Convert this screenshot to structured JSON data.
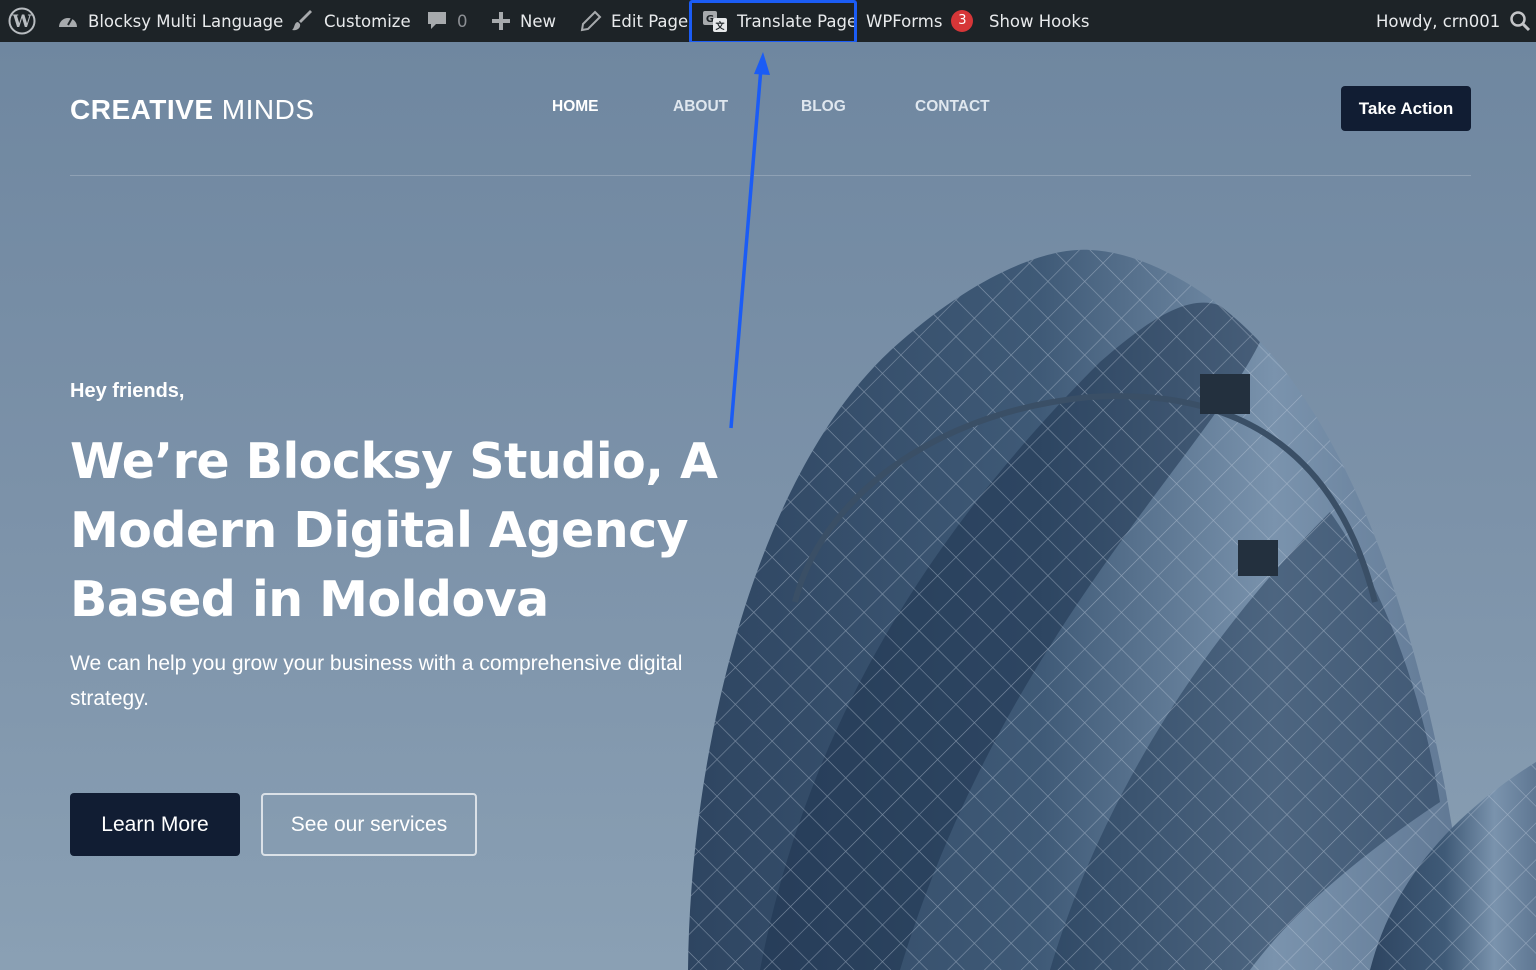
{
  "admin_bar": {
    "wp_logo_icon": "wordpress-icon",
    "site_name": "Blocksy Multi Language",
    "customize": "Customize",
    "comments_count": "0",
    "new": "New",
    "edit_page": "Edit Page",
    "translate_page": "Translate Page",
    "wpforms": "WPForms",
    "wpforms_badge": "3",
    "show_hooks": "Show Hooks",
    "howdy": "Howdy, crn001",
    "highlight_color": "#1b5cf5"
  },
  "header": {
    "logo_bold": "CREATIVE",
    "logo_thin": "MINDS",
    "nav": [
      "HOME",
      "ABOUT",
      "BLOG",
      "CONTACT"
    ],
    "cta": "Take Action"
  },
  "hero": {
    "greeting": "Hey friends,",
    "headline": "We’re Blocksy Studio, A Modern Digital Agency Based in Moldova",
    "subtext": "We can help you grow your business with a comprehensive digital strategy.",
    "primary_button": "Learn More",
    "secondary_button": "See our services"
  },
  "colors": {
    "admin_bg": "#1d2327",
    "dark_navy": "#111d33",
    "annotation_blue": "#1b5cf5",
    "badge_red": "#d63638"
  }
}
